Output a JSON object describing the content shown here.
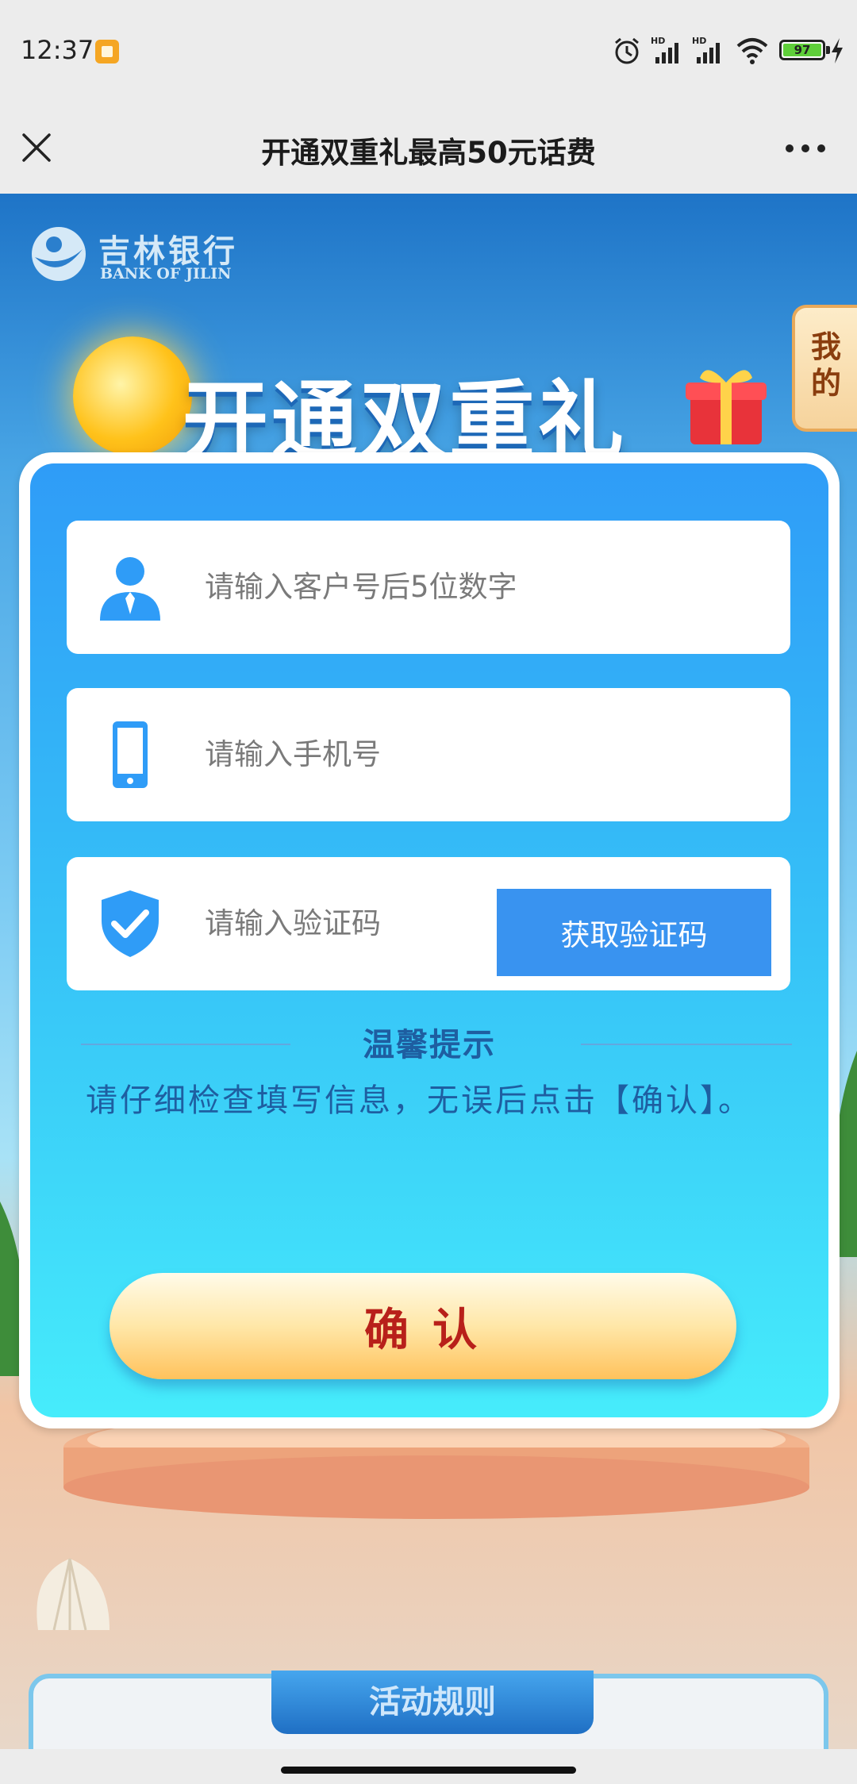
{
  "status_bar": {
    "time": "12:37",
    "battery": "97",
    "icons": [
      "alarm-icon",
      "hd-signal-icon",
      "hd-signal-icon",
      "wifi-icon",
      "battery-icon",
      "charging-icon"
    ]
  },
  "nav": {
    "title": "开通双重礼最高50元话费",
    "close_icon": "close-icon",
    "more_icon": "more-icon"
  },
  "banner": {
    "logo_cn": "吉林银行",
    "logo_en": "BANK OF JILIN",
    "headline": "开通双重礼",
    "side_tab_line1": "我",
    "side_tab_line2": "的"
  },
  "form": {
    "customer_placeholder": "请输入客户号后5位数字",
    "phone_placeholder": "请输入手机号",
    "code_placeholder": "请输入验证码",
    "get_code_label": "获取验证码",
    "tip_title": "温馨提示",
    "tip_text": "请仔细检查填写信息，无误后点击【确认】。",
    "confirm_label": "确认"
  },
  "rules": {
    "tab_label": "活动规则"
  },
  "colors": {
    "card_gradient_top": "#2f9cf7",
    "card_gradient_bottom": "#46ecfb",
    "code_button": "#3993f0",
    "confirm_text": "#b8201a",
    "tip_text": "#1e5ea1"
  }
}
